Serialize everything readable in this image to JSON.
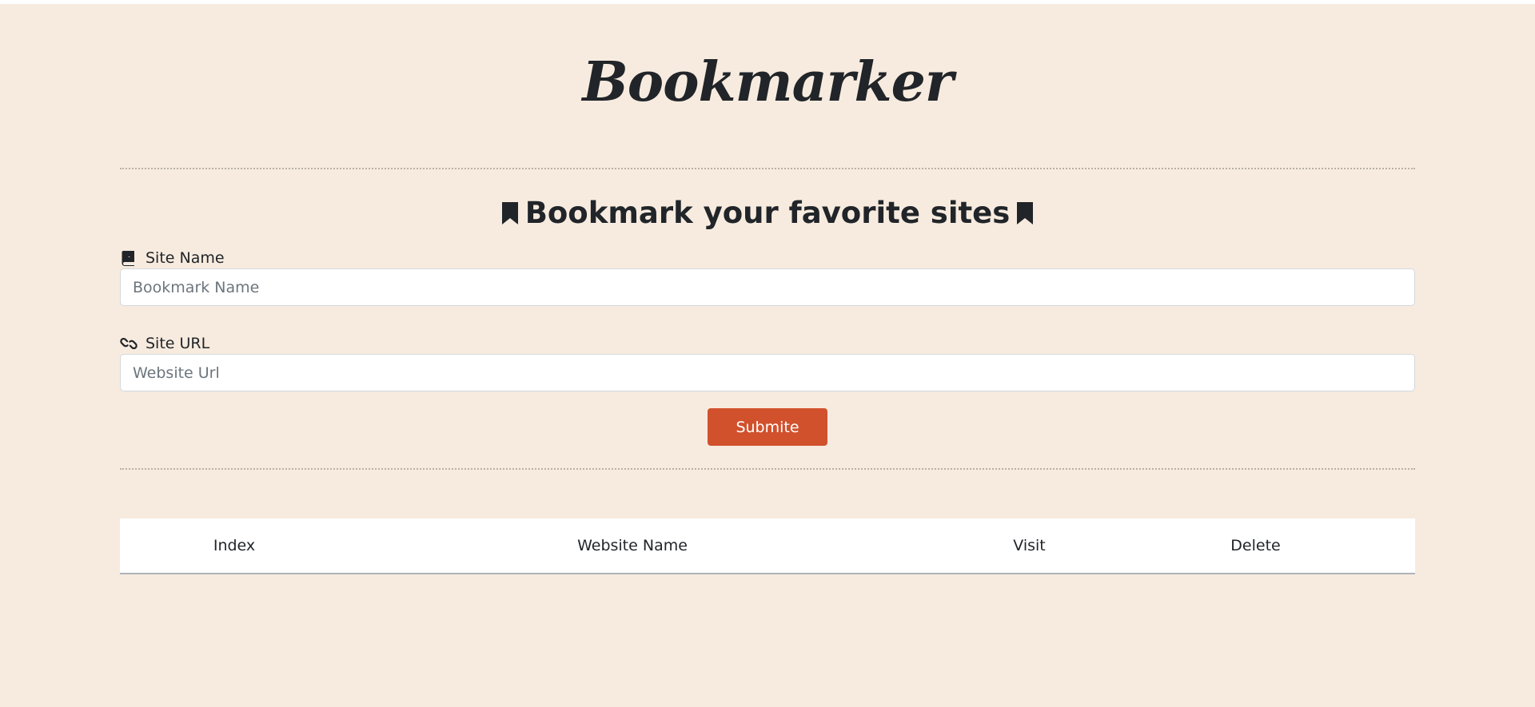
{
  "app": {
    "logo_text": "Bookmarker",
    "logo_highlight_color": "#fdc664",
    "background_color": "#f7ebdf"
  },
  "form": {
    "heading": "Bookmark your favorite sites",
    "heading_icons": [
      "bookmark-icon",
      "bookmark-icon"
    ],
    "site_name": {
      "label": "Site Name",
      "icon": "book-icon",
      "value": "",
      "placeholder": "Bookmark Name"
    },
    "site_url": {
      "label": "Site URL",
      "icon": "link-icon",
      "value": "",
      "placeholder": "Website Url"
    },
    "submit_label": "Submite",
    "submit_color": "#d1512d"
  },
  "table": {
    "columns": [
      "Index",
      "Website Name",
      "Visit",
      "Delete"
    ],
    "rows": []
  }
}
